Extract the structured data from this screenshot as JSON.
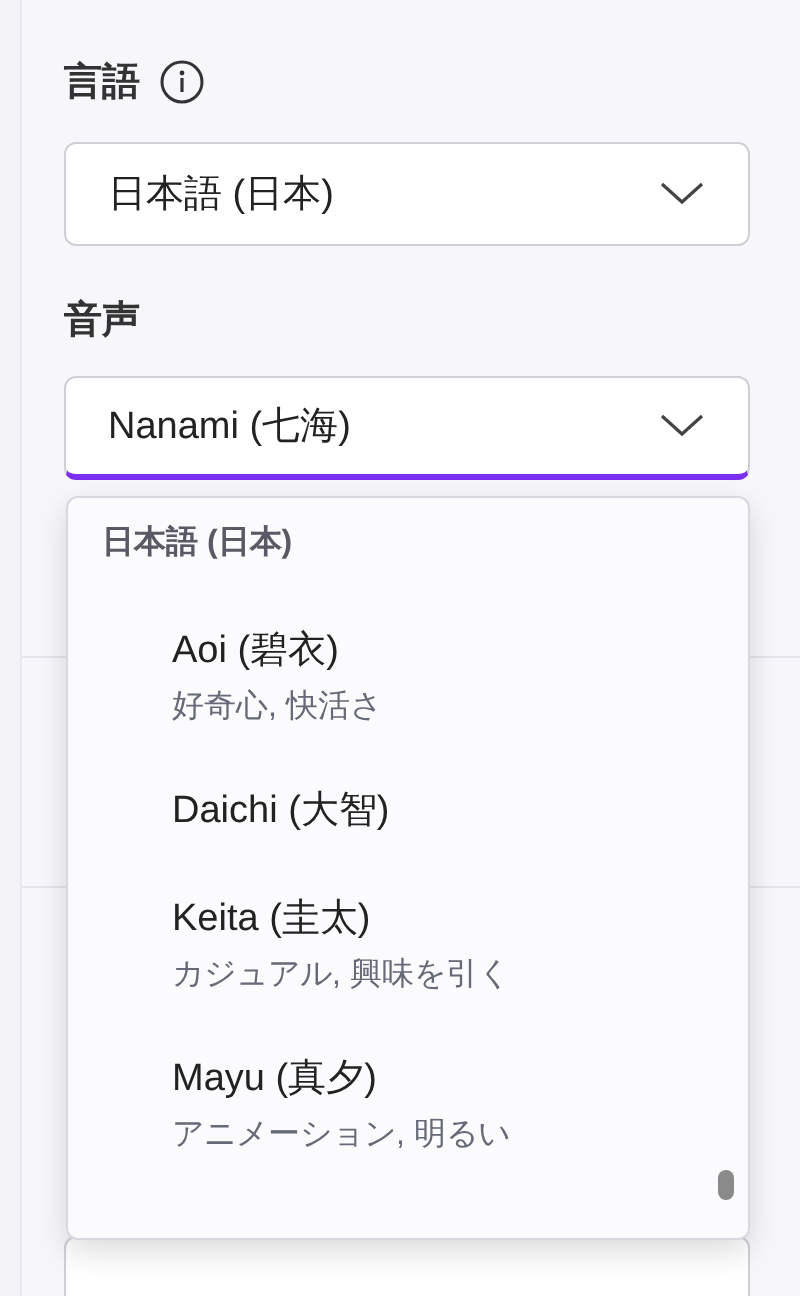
{
  "language": {
    "label": "言語",
    "value": "日本語 (日本)"
  },
  "voice": {
    "label": "音声",
    "value": "Nanami (七海)",
    "focused": true
  },
  "voice_menu": {
    "group": "日本語 (日本)",
    "items": [
      {
        "name": "Aoi (碧衣)",
        "traits": "好奇心, 快活さ"
      },
      {
        "name": "Daichi (大智)"
      },
      {
        "name": "Keita (圭太)",
        "traits": "カジュアル, 興味を引く"
      },
      {
        "name": "Mayu (真夕)",
        "traits": "アニメーション, 明るい"
      }
    ]
  }
}
